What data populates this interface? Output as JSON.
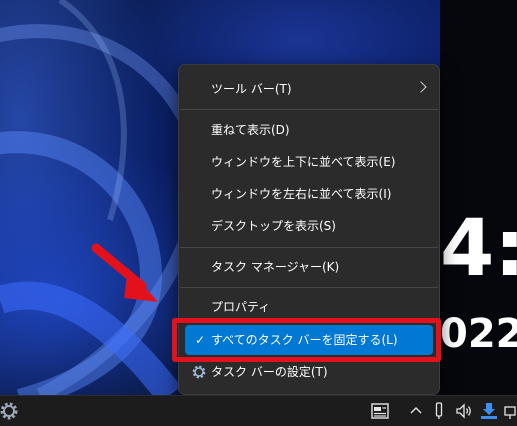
{
  "context_menu": {
    "items": [
      {
        "label": "ツール バー(T)",
        "has_submenu": true
      },
      {
        "label": "重ねて表示(D)"
      },
      {
        "label": "ウィンドウを上下に並べて表示(E)"
      },
      {
        "label": "ウィンドウを左右に並べて表示(I)"
      },
      {
        "label": "デスクトップを表示(S)"
      },
      {
        "label": "タスク マネージャー(K)"
      },
      {
        "label": "プロパティ"
      },
      {
        "label": "すべてのタスク バーを固定する(L)",
        "checked": true,
        "check_glyph": "✓",
        "highlighted": true
      },
      {
        "label": "タスク バーの設定(T)",
        "icon": "gear-icon"
      }
    ]
  },
  "desktop_clock": {
    "time_partial": "4:",
    "date_partial": "022/"
  },
  "taskbar": {
    "left_icon": "gear-icon",
    "tray_icons": [
      "widgets-icon",
      "chevron-up-icon",
      "pen-icon",
      "speaker-icon",
      "download-icon",
      "network-icon"
    ]
  },
  "colors": {
    "menu_bg": "#2b2b2b",
    "selected_bg": "#0078d4",
    "highlight_red": "#e3111c",
    "taskbar_bg": "#1c1c1c"
  }
}
